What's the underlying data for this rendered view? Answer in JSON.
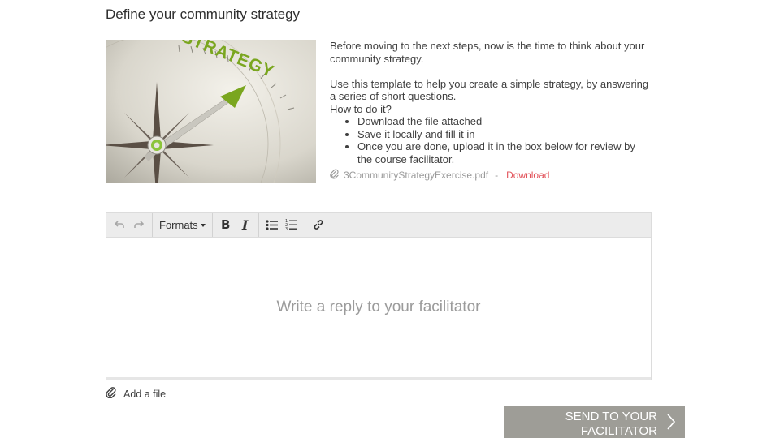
{
  "section": {
    "title": "Define your community strategy"
  },
  "hero_image": {
    "logo_text": "STRATEGY",
    "alt": "compass-strategy-image"
  },
  "intro": {
    "paragraph1": "Before moving to the next steps, now is the time to think about your community strategy.",
    "paragraph2": "Use this template to help you create a simple strategy, by answering a series of short questions.",
    "how_to": "How to do it?",
    "steps": [
      "Download the file attached",
      "Save it locally and fill it in",
      "Once you are done, upload it in the box below for review by the course facilitator."
    ]
  },
  "attachment": {
    "filename": "3CommunityStrategyExercise.pdf",
    "separator": "-",
    "download_label": "Download",
    "icon": "paperclip-icon"
  },
  "editor": {
    "formats_label": "Formats",
    "bold_label": "B",
    "italic_label": "I",
    "placeholder": "Write a reply to your facilitator"
  },
  "add_file": {
    "label": "Add a file",
    "icon": "paperclip-icon"
  },
  "send": {
    "line1": "SEND TO YOUR",
    "line2": "FACILITATOR"
  },
  "colors": {
    "accent_link": "#e2525a",
    "button_bg": "#9e9d97",
    "strategy_green": "#7aa61f"
  }
}
